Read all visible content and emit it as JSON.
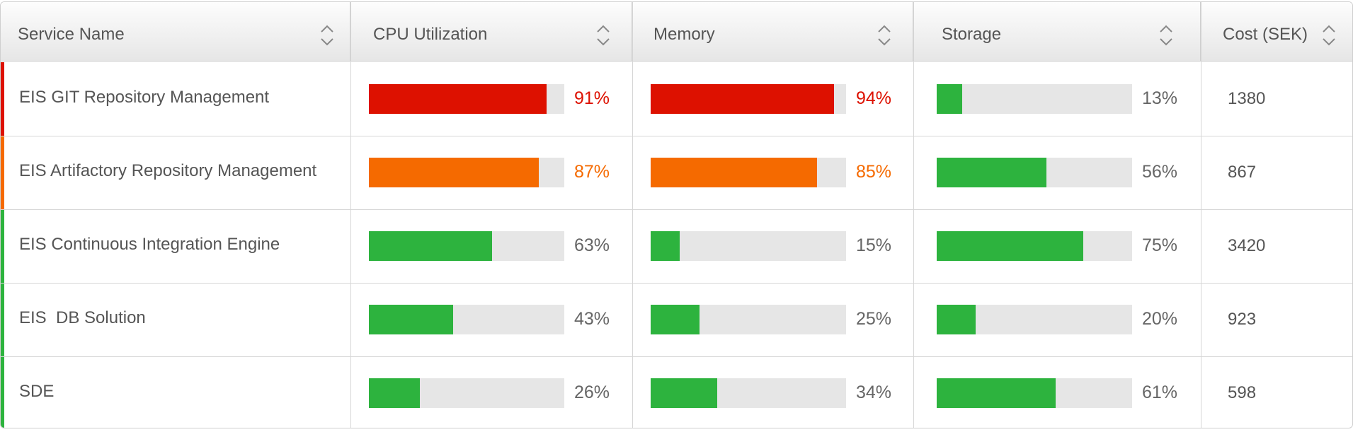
{
  "colors": {
    "critical": "#dd1100",
    "warning": "#f56a00",
    "ok": "#2db33e",
    "neutral_text": "#666666",
    "track": "#e6e6e6"
  },
  "columns": [
    {
      "key": "service",
      "label": "Service Name",
      "sort_icon": "sort-icon"
    },
    {
      "key": "cpu",
      "label": "CPU Utilization",
      "sort_icon": "sort-icon"
    },
    {
      "key": "memory",
      "label": "Memory",
      "sort_icon": "sort-icon"
    },
    {
      "key": "storage",
      "label": "Storage",
      "sort_icon": "sort-icon"
    },
    {
      "key": "cost",
      "label": "Cost (SEK)",
      "sort_icon": "sort-icon"
    }
  ],
  "rows": [
    {
      "name": "EIS GIT Repository Management",
      "status": "critical",
      "cpu": 91,
      "cpu_label": "91%",
      "memory": 94,
      "memory_label": "94%",
      "storage": 13,
      "storage_label": "13%",
      "cost": "1380"
    },
    {
      "name": "EIS Artifactory Repository Management",
      "status": "warning",
      "cpu": 87,
      "cpu_label": "87%",
      "memory": 85,
      "memory_label": "85%",
      "storage": 56,
      "storage_label": "56%",
      "cost": "867"
    },
    {
      "name": "EIS Continuous Integration Engine",
      "status": "ok",
      "cpu": 63,
      "cpu_label": "63%",
      "memory": 15,
      "memory_label": "15%",
      "storage": 75,
      "storage_label": "75%",
      "cost": "3420"
    },
    {
      "name": "EIS  DB Solution",
      "status": "ok",
      "cpu": 43,
      "cpu_label": "43%",
      "memory": 25,
      "memory_label": "25%",
      "storage": 20,
      "storage_label": "20%",
      "cost": "923"
    },
    {
      "name": "SDE",
      "status": "ok",
      "cpu": 26,
      "cpu_label": "26%",
      "memory": 34,
      "memory_label": "34%",
      "storage": 61,
      "storage_label": "61%",
      "cost": "598"
    }
  ]
}
